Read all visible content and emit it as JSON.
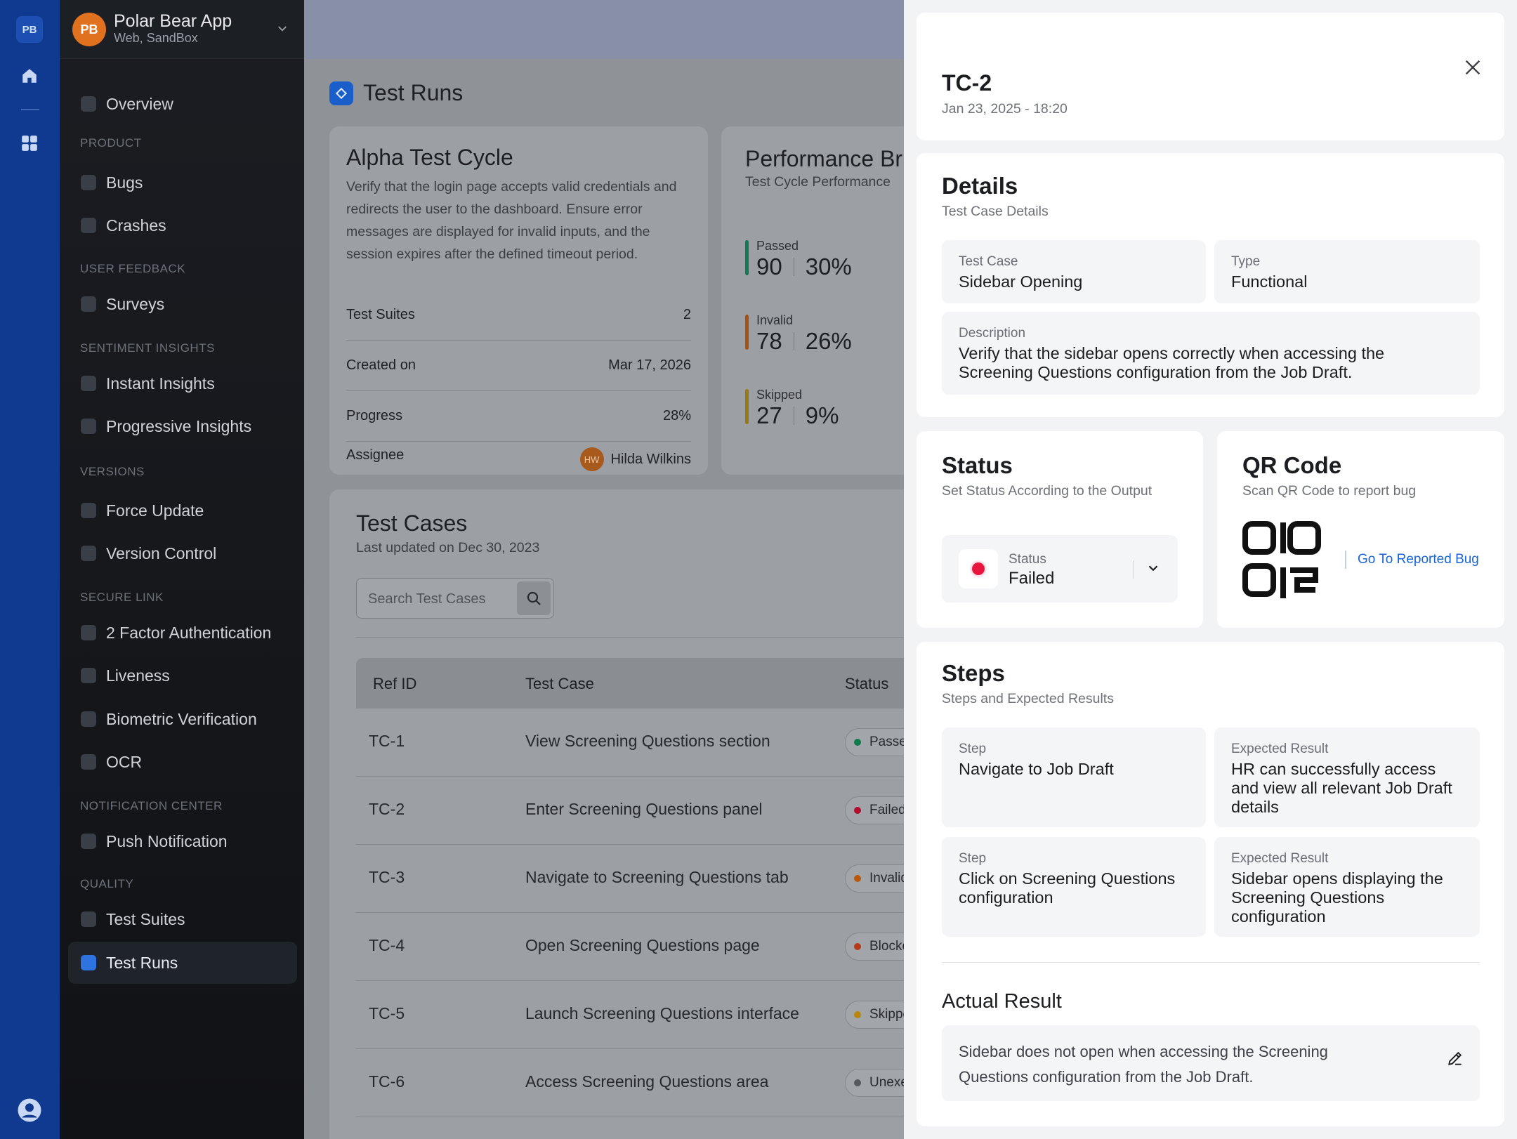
{
  "rail": {
    "logo": "PB",
    "icons": [
      "home-icon",
      "grid-icon",
      "account-circle-icon"
    ]
  },
  "app": {
    "avatar": "PB",
    "name": "Polar Bear App",
    "subtitle": "Web, SandBox"
  },
  "nav": {
    "overview": "Overview",
    "product_label": "PRODUCT",
    "bugs": "Bugs",
    "crashes": "Crashes",
    "user_feedback_label": "USER FEEDBACK",
    "surveys": "Surveys",
    "sentiment_label": "SENTIMENT INSIGHTS",
    "instant_insights": "Instant Insights",
    "progressive_insights": "Progressive Insights",
    "versions_label": "VERSIONS",
    "force_update": "Force Update",
    "version_control": "Version Control",
    "secure_link_label": "SECURE LINK",
    "two_factor": "2 Factor Authentication",
    "liveness": "Liveness",
    "biometric": "Biometric Verification",
    "ocr": "OCR",
    "notification_label": "NOTIFICATION CENTER",
    "push_notification": "Push Notification",
    "quality_label": "QUALITY",
    "test_suites": "Test Suites",
    "test_runs": "Test Runs"
  },
  "main": {
    "page_title": "Test Runs",
    "cycle": {
      "title": "Alpha Test Cycle",
      "description": "Verify that the login page accepts valid credentials and redirects the user to the dashboard. Ensure error messages are displayed for invalid inputs, and the session expires after the defined timeout period.",
      "test_suites_label": "Test Suites",
      "test_suites_value": "2",
      "created_label": "Created on",
      "created_value": "Mar 17, 2026",
      "progress_label": "Progress",
      "progress_value": "28%",
      "assignee_label": "Assignee",
      "assignee_initials": "HW",
      "assignee_name": "Hilda Wilkins"
    },
    "performance": {
      "title": "Performance Br",
      "subtitle": "Test Cycle Performance",
      "stats": [
        {
          "label": "Passed",
          "count": "90",
          "percent": "30%",
          "color": "#0f7a55"
        },
        {
          "label": "Invalid",
          "count": "78",
          "percent": "26%",
          "color": "#a8520e"
        },
        {
          "label": "Skipped",
          "count": "27",
          "percent": "9%",
          "color": "#9a7a10"
        }
      ]
    },
    "test_cases": {
      "title": "Test Cases",
      "subtitle": "Last updated on Dec 30, 2023",
      "search_placeholder": "Search Test Cases",
      "headers": {
        "ref": "Ref ID",
        "case": "Test Case",
        "status": "Status"
      },
      "rows": [
        {
          "ref": "TC-1",
          "case": "View Screening Questions section",
          "status": "Passed",
          "dot": "#0d7a4d"
        },
        {
          "ref": "TC-2",
          "case": "Enter Screening Questions panel",
          "status": "Failed",
          "dot": "#b00e2c"
        },
        {
          "ref": "TC-3",
          "case": "Navigate to Screening Questions tab",
          "status": "Invalid",
          "dot": "#b85a0c"
        },
        {
          "ref": "TC-4",
          "case": "Open Screening Questions page",
          "status": "Blocked",
          "dot": "#b33a1a"
        },
        {
          "ref": "TC-5",
          "case": "Launch Screening Questions interface",
          "status": "Skipped",
          "dot": "#b8860c"
        },
        {
          "ref": "TC-6",
          "case": "Access Screening Questions area",
          "status": "Unexecuted",
          "dot": "#55585d"
        }
      ]
    }
  },
  "drawer": {
    "title": "TC-2",
    "date": "Jan 23, 2025 - 18:20",
    "details": {
      "title": "Details",
      "subtitle": "Test Case Details",
      "test_case_label": "Test Case",
      "test_case_value": "Sidebar Opening",
      "type_label": "Type",
      "type_value": "Functional",
      "description_label": "Description",
      "description_value": "Verify that the sidebar opens correctly when accessing the Screening Questions configuration from the Job Draft."
    },
    "status": {
      "title": "Status",
      "subtitle": "Set Status According to the Output",
      "label": "Status",
      "value": "Failed",
      "color": "#e8163e"
    },
    "qr": {
      "title": "QR Code",
      "subtitle": "Scan QR Code to report bug",
      "link": "Go To Reported Bug"
    },
    "steps": {
      "title": "Steps",
      "subtitle": "Steps and Expected Results",
      "step_label": "Step",
      "expected_label": "Expected Result",
      "items": [
        {
          "step": "Navigate to Job Draft",
          "expected": "HR can successfully access and view all relevant Job Draft details"
        },
        {
          "step": "Click on Screening Questions configuration",
          "expected": "Sidebar opens displaying the Screening Questions configuration"
        }
      ]
    },
    "actual": {
      "title": "Actual Result",
      "text": "Sidebar does not open when accessing the Screening Questions configuration from the Job Draft."
    }
  }
}
